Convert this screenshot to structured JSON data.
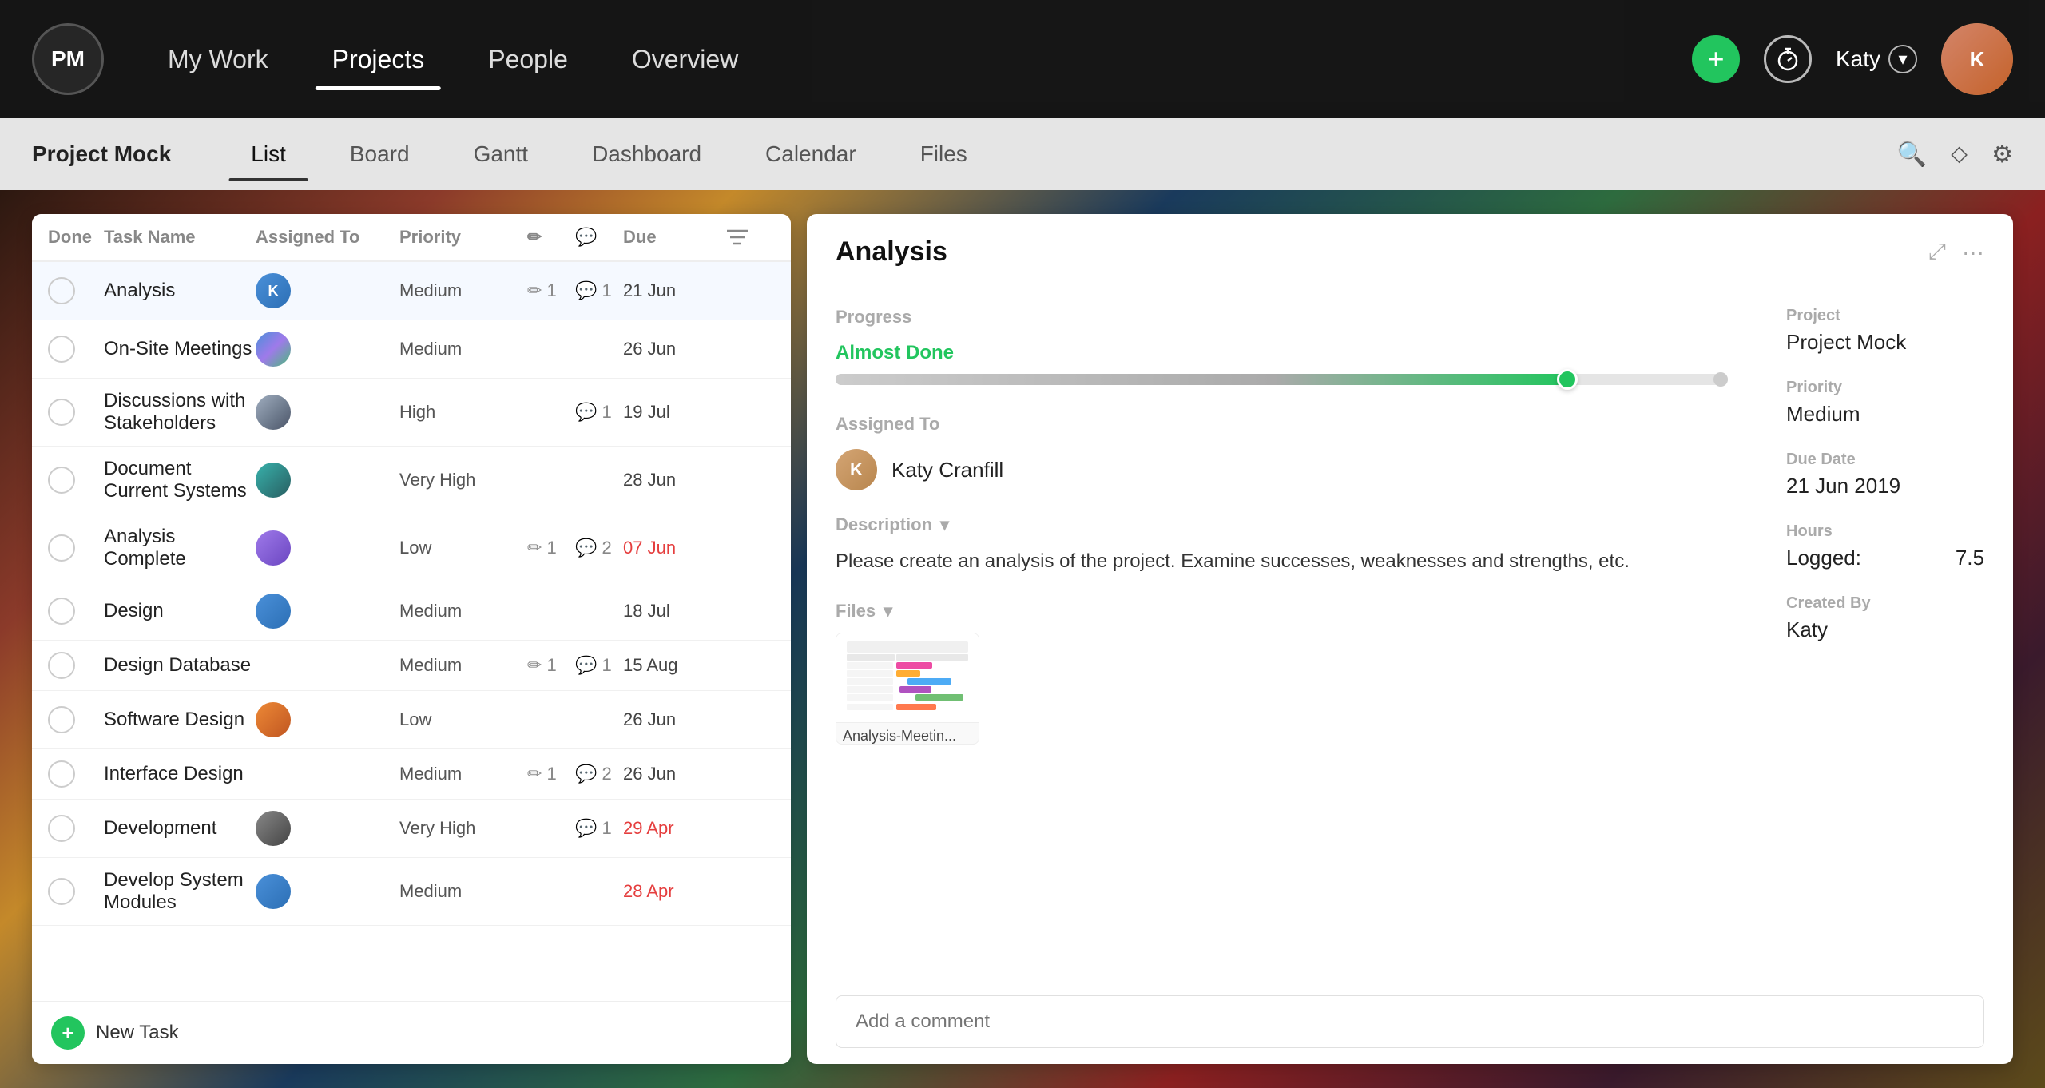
{
  "app": {
    "logo": "PM",
    "nav_links": [
      {
        "label": "My Work",
        "active": false
      },
      {
        "label": "Projects",
        "active": true
      },
      {
        "label": "People",
        "active": false
      },
      {
        "label": "Overview",
        "active": false
      }
    ],
    "user_name": "Katy",
    "add_icon": "+",
    "timer_icon": "⏱",
    "search_icon": "🔍",
    "filter_icon": "⬦",
    "settings_icon": "⚙"
  },
  "secondary_nav": {
    "project_title": "Project Mock",
    "tabs": [
      {
        "label": "List",
        "active": true
      },
      {
        "label": "Board",
        "active": false
      },
      {
        "label": "Gantt",
        "active": false
      },
      {
        "label": "Dashboard",
        "active": false
      },
      {
        "label": "Calendar",
        "active": false
      },
      {
        "label": "Files",
        "active": false
      }
    ]
  },
  "task_list": {
    "columns": {
      "done": "Done",
      "task_name": "Task Name",
      "assigned_to": "Assigned To",
      "priority": "Priority",
      "edit_icon": "✏",
      "comment_icon": "💬",
      "due": "Due",
      "filter_icon": "≡"
    },
    "tasks": [
      {
        "id": 1,
        "name": "Analysis",
        "assigned_avatar": "blue",
        "priority": "Medium",
        "edit_count": 1,
        "comment_count": 1,
        "due": "21 Jun",
        "overdue": false,
        "selected": true
      },
      {
        "id": 2,
        "name": "On-Site Meetings",
        "assigned_avatar": "multi",
        "priority": "Medium",
        "edit_count": 0,
        "comment_count": 0,
        "due": "26 Jun",
        "overdue": false,
        "selected": false
      },
      {
        "id": 3,
        "name": "Discussions with Stakeholders",
        "assigned_avatar": "gray2",
        "priority": "High",
        "edit_count": 0,
        "comment_count": 1,
        "due": "19 Jul",
        "overdue": false,
        "selected": false
      },
      {
        "id": 4,
        "name": "Document Current Systems",
        "assigned_avatar": "blue2",
        "priority": "Very High",
        "edit_count": 0,
        "comment_count": 0,
        "due": "28 Jun",
        "overdue": false,
        "selected": false
      },
      {
        "id": 5,
        "name": "Analysis Complete",
        "assigned_avatar": "multi2",
        "priority": "Low",
        "edit_count": 1,
        "comment_count": 2,
        "due": "07 Jun",
        "overdue": true,
        "selected": false
      },
      {
        "id": 6,
        "name": "Design",
        "assigned_avatar": "blue3",
        "priority": "Medium",
        "edit_count": 0,
        "comment_count": 0,
        "due": "18 Jul",
        "overdue": false,
        "selected": false
      },
      {
        "id": 7,
        "name": "Design Database",
        "assigned_avatar": "",
        "priority": "Medium",
        "edit_count": 1,
        "comment_count": 1,
        "due": "15 Aug",
        "overdue": false,
        "selected": false
      },
      {
        "id": 8,
        "name": "Software Design",
        "assigned_avatar": "blue4",
        "priority": "Low",
        "edit_count": 0,
        "comment_count": 0,
        "due": "26 Jun",
        "overdue": false,
        "selected": false
      },
      {
        "id": 9,
        "name": "Interface Design",
        "assigned_avatar": "",
        "priority": "Medium",
        "edit_count": 1,
        "comment_count": 2,
        "due": "26 Jun",
        "overdue": false,
        "selected": false
      },
      {
        "id": 10,
        "name": "Development",
        "assigned_avatar": "gray3",
        "priority": "Very High",
        "edit_count": 0,
        "comment_count": 1,
        "due": "29 Apr",
        "overdue": true,
        "selected": false
      },
      {
        "id": 11,
        "name": "Develop System Modules",
        "assigned_avatar": "blue5",
        "priority": "Medium",
        "edit_count": 0,
        "comment_count": 0,
        "due": "28 Apr",
        "overdue": true,
        "selected": false
      }
    ],
    "new_task_label": "New Task"
  },
  "analysis_panel": {
    "title": "Analysis",
    "progress_label": "Progress",
    "progress_status": "Almost Done",
    "progress_percent": 82,
    "assigned_to_label": "Assigned To",
    "assignee_name": "Katy Cranfill",
    "description_label": "Description",
    "description_text": "Please create an analysis of the project. Examine successes, weaknesses and strengths, etc.",
    "files_label": "Files",
    "file_name": "Analysis-Meetin...",
    "comment_placeholder": "Add a comment",
    "meta": {
      "project_label": "Project",
      "project_value": "Project Mock",
      "priority_label": "Priority",
      "priority_value": "Medium",
      "due_date_label": "Due Date",
      "due_date_value": "21 Jun 2019",
      "hours_label": "Hours",
      "logged_label": "Logged:",
      "logged_value": "7.5",
      "created_by_label": "Created By",
      "created_by_value": "Katy"
    }
  }
}
